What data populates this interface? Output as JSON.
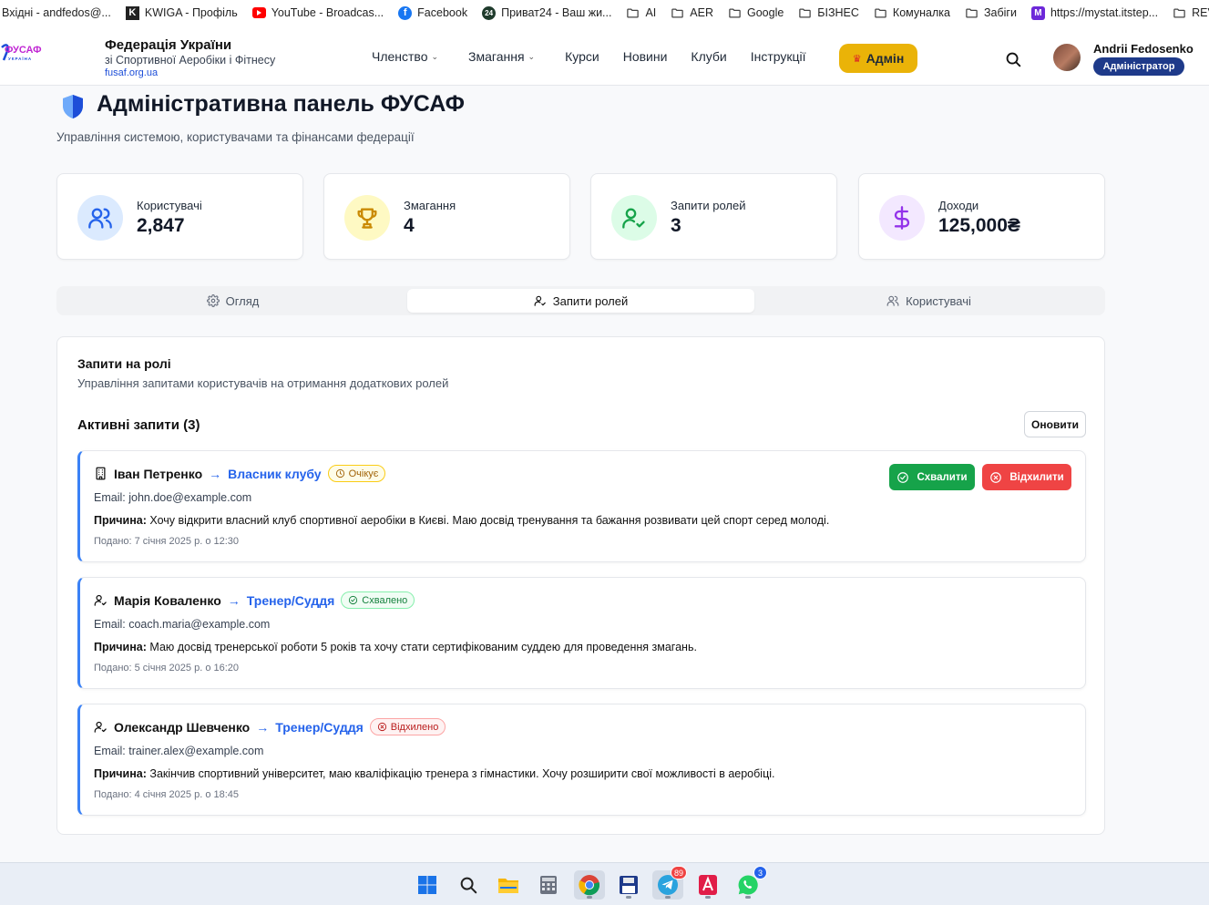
{
  "bookmarks": [
    {
      "label": "Вхідні - andfedos@...",
      "icon": "gmail-icon"
    },
    {
      "label": "KWIGA - Профіль",
      "icon": "kwiga-icon"
    },
    {
      "label": "YouTube - Broadcas...",
      "icon": "youtube-icon"
    },
    {
      "label": "Facebook",
      "icon": "facebook-icon"
    },
    {
      "label": "Приват24 - Ваш жи...",
      "icon": "privat24-icon"
    },
    {
      "label": "AI",
      "icon": "folder-icon"
    },
    {
      "label": "AER",
      "icon": "folder-icon"
    },
    {
      "label": "Google",
      "icon": "folder-icon"
    },
    {
      "label": "БІЗНЕС",
      "icon": "folder-icon"
    },
    {
      "label": "Комуналка",
      "icon": "folder-icon"
    },
    {
      "label": "Забіги",
      "icon": "folder-icon"
    },
    {
      "label": "https://mystat.itstep...",
      "icon": "mystat-icon"
    },
    {
      "label": "REVIT",
      "icon": "folder-icon"
    }
  ],
  "header": {
    "logo_text": "ФУСАФ",
    "logo_sub": "УКРАЇНА",
    "title": "Федерація України",
    "subtitle": "зі Спортивної Аеробіки і Фітнесу",
    "site": "fusaf.org.ua",
    "nav": [
      {
        "label": "Членство",
        "has_dropdown": true
      },
      {
        "label": "Змагання",
        "has_dropdown": true
      },
      {
        "label": "Курси",
        "has_dropdown": false
      },
      {
        "label": "Новини",
        "has_dropdown": false
      },
      {
        "label": "Клуби",
        "has_dropdown": false
      },
      {
        "label": "Інструкції",
        "has_dropdown": false
      }
    ],
    "admin_label": "Адмін",
    "user_name": "Andrii Fedosenko",
    "user_role": "Адміністратор"
  },
  "page": {
    "title": "Адміністративна панель ФУСАФ",
    "subtitle": "Управління системою, користувачами та фінансами федерації"
  },
  "stats": [
    {
      "label": "Користувачі",
      "value": "2,847",
      "icon": "users-icon",
      "bg": "#dbeafe",
      "color": "#2563eb"
    },
    {
      "label": "Змагання",
      "value": "4",
      "icon": "trophy-icon",
      "bg": "#fef9c3",
      "color": "#ca8a04"
    },
    {
      "label": "Запити ролей",
      "value": "3",
      "icon": "user-check-icon",
      "bg": "#dcfce7",
      "color": "#16a34a"
    },
    {
      "label": "Доходи",
      "value": "125,000₴",
      "icon": "dollar-icon",
      "bg": "#f3e8ff",
      "color": "#9333ea"
    }
  ],
  "tabs": [
    {
      "label": "Огляд",
      "icon": "gear-icon",
      "active": false
    },
    {
      "label": "Запити ролей",
      "icon": "user-check-icon",
      "active": true
    },
    {
      "label": "Користувачі",
      "icon": "users-icon",
      "active": false
    }
  ],
  "panel": {
    "title": "Запити на ролі",
    "description": "Управління запитами користувачів на отримання додаткових ролей",
    "active_title": "Активні запити (3)",
    "refresh_label": "Оновити",
    "email_prefix": "Email:",
    "reason_prefix": "Причина:",
    "approve_label": "Схвалити",
    "reject_label": "Відхилити"
  },
  "requests": [
    {
      "name": "Іван Петренко",
      "role": "Власник клубу",
      "status": "Очікує",
      "status_type": "pending",
      "icon": "building-icon",
      "email": "john.doe@example.com",
      "reason": "Хочу відкрити власний клуб спортивної аеробіки в Києві. Маю досвід тренування та бажання розвивати цей спорт серед молоді.",
      "submitted": "Подано: 7 січня 2025 р. о 12:30"
    },
    {
      "name": "Марія Коваленко",
      "role": "Тренер/Суддя",
      "status": "Схвалено",
      "status_type": "approved",
      "icon": "user-check-icon",
      "email": "coach.maria@example.com",
      "reason": "Маю досвід тренерської роботи 5 років та хочу стати сертифікованим суддею для проведення змагань.",
      "submitted": "Подано: 5 січня 2025 р. о 16:20"
    },
    {
      "name": "Олександр Шевченко",
      "role": "Тренер/Суддя",
      "status": "Відхилено",
      "status_type": "rejected",
      "icon": "user-check-icon",
      "email": "trainer.alex@example.com",
      "reason": "Закінчив спортивний університет, маю кваліфікацію тренера з гімнастики. Хочу розширити свої можливості в аеробіці.",
      "submitted": "Подано: 4 січня 2025 р. о 18:45"
    }
  ],
  "taskbar": [
    {
      "name": "start-icon"
    },
    {
      "name": "search-icon"
    },
    {
      "name": "file-explorer-icon"
    },
    {
      "name": "calculator-icon"
    },
    {
      "name": "chrome-icon",
      "selected": true
    },
    {
      "name": "save-app-icon"
    },
    {
      "name": "telegram-icon",
      "badge": "89",
      "selected": true
    },
    {
      "name": "autocad-icon"
    },
    {
      "name": "whatsapp-icon",
      "badge": "3"
    }
  ]
}
